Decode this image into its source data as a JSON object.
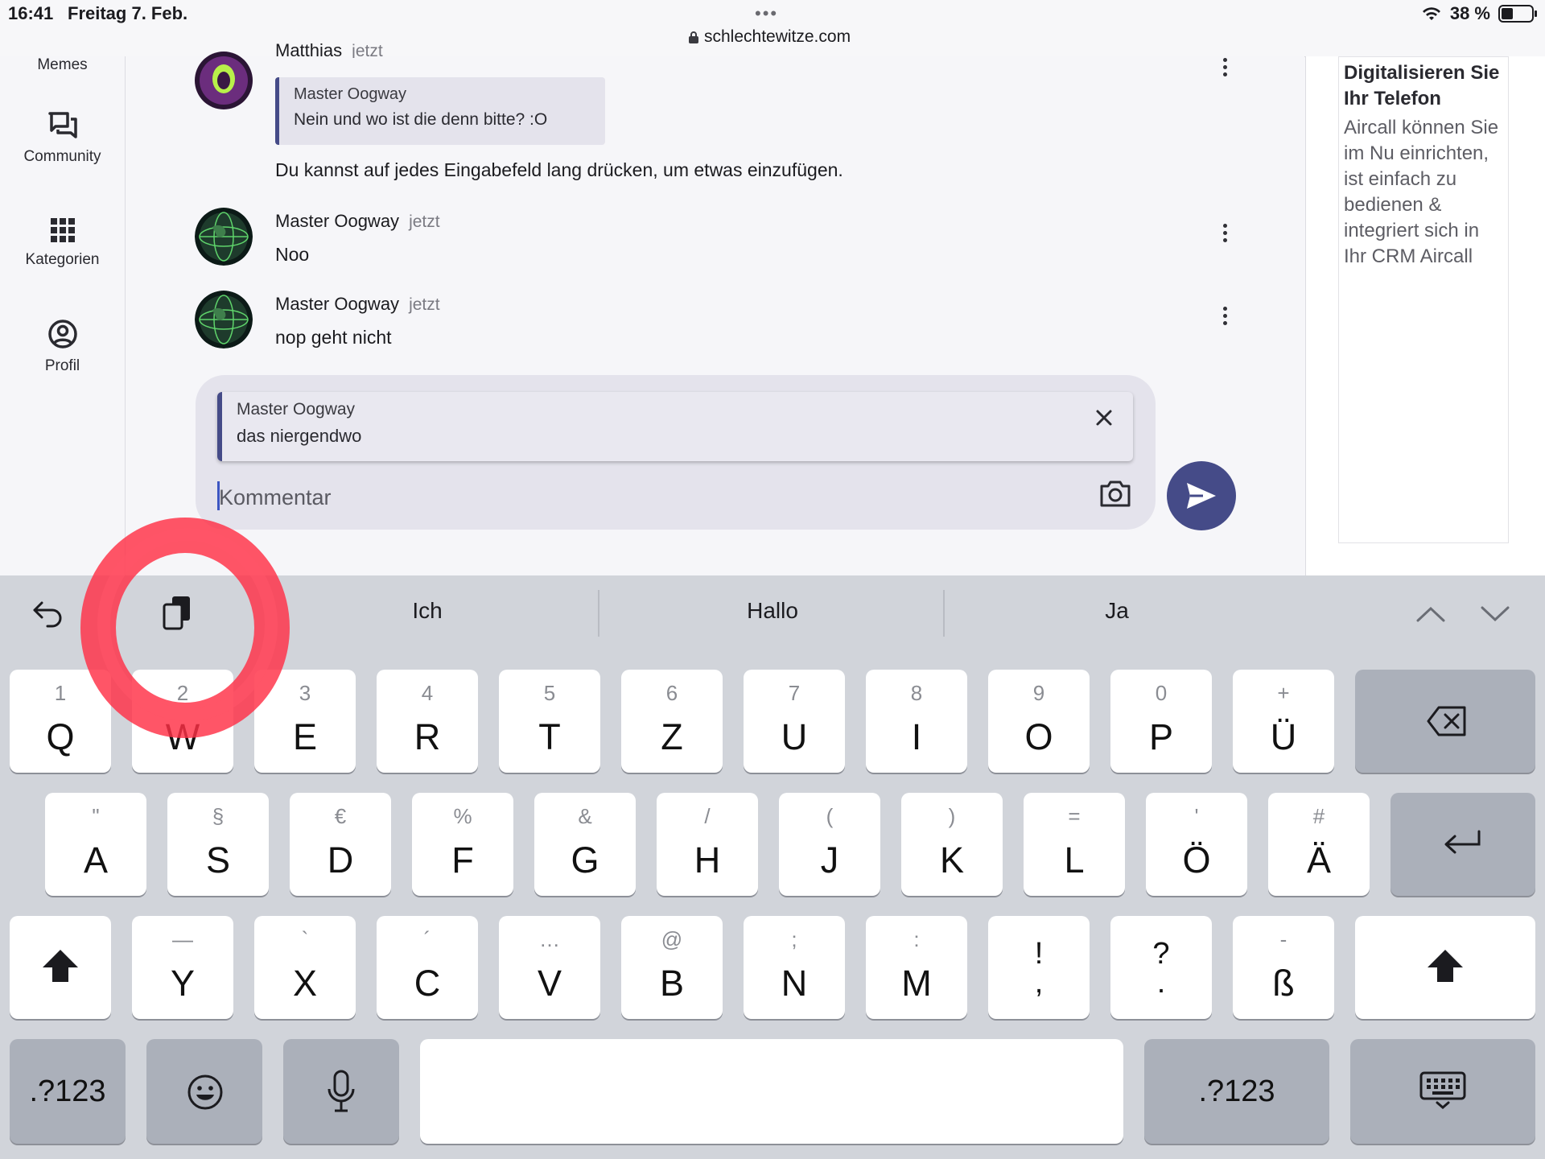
{
  "status_bar": {
    "time": "16:41",
    "date": "Freitag 7. Feb.",
    "dots": "•••",
    "url": "schlechtewitze.com",
    "battery": "38 %",
    "battery_level": 0.38
  },
  "sidebar": {
    "items": [
      {
        "label": "Memes"
      },
      {
        "label": "Community"
      },
      {
        "label": "Kategorien"
      },
      {
        "label": "Profil"
      }
    ]
  },
  "chat": {
    "partial_author": "Matthias",
    "partial_time": "jetzt",
    "quote_author": "Master Oogway",
    "quote_text": "Nein und wo ist die denn bitte? :O",
    "first_message": "Du kannst auf jedes Eingabefeld lang drücken, um etwas einzufügen.",
    "messages": [
      {
        "author": "Master Oogway",
        "time": "jetzt",
        "text": "Noo"
      },
      {
        "author": "Master Oogway",
        "time": "jetzt",
        "text": "nop geht nicht"
      }
    ]
  },
  "comment": {
    "reply_author": "Master Oogway",
    "reply_text": "das niergendwo",
    "placeholder": "Kommentar"
  },
  "ad": {
    "title": "Digitalisieren Sie Ihr Telefon",
    "body": "Aircall können Sie im Nu einrichten, ist einfach zu bedienen & integriert sich in Ihr CRM Aircall"
  },
  "keyboard": {
    "suggestions": [
      "Ich",
      "Hallo",
      "Ja"
    ],
    "row1": [
      {
        "sub": "1",
        "main": "Q"
      },
      {
        "sub": "2",
        "main": "W"
      },
      {
        "sub": "3",
        "main": "E"
      },
      {
        "sub": "4",
        "main": "R"
      },
      {
        "sub": "5",
        "main": "T"
      },
      {
        "sub": "6",
        "main": "Z"
      },
      {
        "sub": "7",
        "main": "U"
      },
      {
        "sub": "8",
        "main": "I"
      },
      {
        "sub": "9",
        "main": "O"
      },
      {
        "sub": "0",
        "main": "P"
      },
      {
        "sub": "+",
        "main": "Ü"
      }
    ],
    "row2": [
      {
        "sub": "\"",
        "main": "A"
      },
      {
        "sub": "§",
        "main": "S"
      },
      {
        "sub": "€",
        "main": "D"
      },
      {
        "sub": "%",
        "main": "F"
      },
      {
        "sub": "&",
        "main": "G"
      },
      {
        "sub": "/",
        "main": "H"
      },
      {
        "sub": "(",
        "main": "J"
      },
      {
        "sub": ")",
        "main": "K"
      },
      {
        "sub": "=",
        "main": "L"
      },
      {
        "sub": "'",
        "main": "Ö"
      },
      {
        "sub": "#",
        "main": "Ä"
      }
    ],
    "row3": [
      {
        "sub": "—",
        "main": "Y"
      },
      {
        "sub": "`",
        "main": "X"
      },
      {
        "sub": "´",
        "main": "C"
      },
      {
        "sub": "…",
        "main": "V"
      },
      {
        "sub": "@",
        "main": "B"
      },
      {
        "sub": ";",
        "main": "N"
      },
      {
        "sub": ":",
        "main": "M"
      },
      {
        "sub": "!",
        "main": ","
      },
      {
        "sub": "?",
        "main": "."
      },
      {
        "sub": "-",
        "main": "ß"
      }
    ],
    "numbers_label": ".?123"
  }
}
